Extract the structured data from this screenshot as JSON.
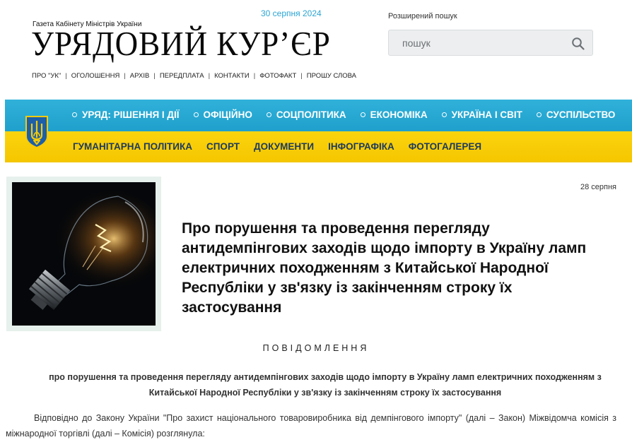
{
  "header": {
    "subtitle": "Газета Кабінету Міністрів України",
    "masthead": "УРЯДОВИЙ КУР’ЄР",
    "issue_date": "30 серпня 2024",
    "advanced_search": "Розширений пошук",
    "search_placeholder": "пошук",
    "top_links": [
      "ПРО \"УК\"",
      "ОГОЛОШЕННЯ",
      "АРХІВ",
      "ПЕРЕДПЛАТА",
      "КОНТАКТИ",
      "ФОТОФАКТ",
      "ПРОШУ СЛОВА"
    ]
  },
  "nav": {
    "primary": [
      "УРЯД: РІШЕННЯ І ДІЇ",
      "ОФІЦІЙНО",
      "СОЦПОЛІТИКА",
      "ЕКОНОМІКА",
      "УКРАЇНА І СВІТ",
      "СУСПІЛЬСТВО"
    ],
    "secondary": [
      "ГУМАНІТАРНА ПОЛІТИКА",
      "СПОРТ",
      "ДОКУМЕНТИ",
      "ІНФОГРАФІКА",
      "ФОТОГАЛЕРЕЯ"
    ]
  },
  "article": {
    "date": "28 серпня",
    "title": "Про порушення та проведення перегляду антидемпінгових заходів щодо імпорту в Україну ламп електричних походженням з Китайської Народної Республіки у зв'язку із закінченням строку їх застосування",
    "notice_heading": "ПОВІДОМЛЕННЯ",
    "notice_sub": "про порушення та проведення перегляду антидемпінгових заходів щодо імпорту в Україну ламп електричних походженням з Китайської Народної Республіки у зв'язку із закінченням строку їх застосування",
    "body": "Відповідно до Закону України \"Про захист національного товаровиробника від демпінгового імпорту\" (далі – Закон) Міжвідомча комісія з міжнародної торгівлі (далі – Комісія) розглянула:"
  },
  "colors": {
    "nav_blue": "#22a3cf",
    "nav_yellow": "#f7cb05",
    "date_accent": "#2aa5d4"
  },
  "icons": {
    "search": "magnifier-icon",
    "coat_of_arms": "trident-icon"
  }
}
